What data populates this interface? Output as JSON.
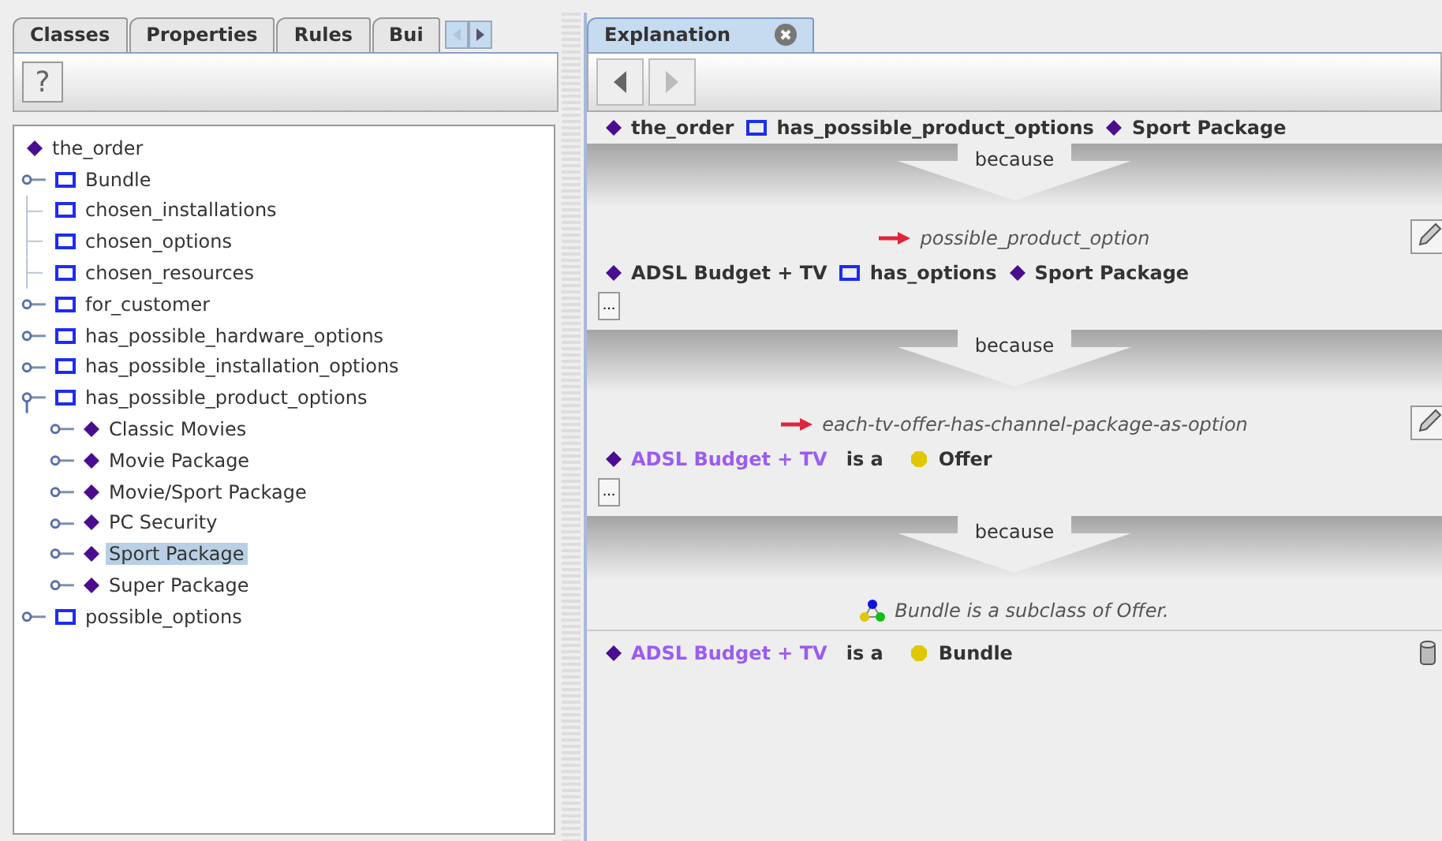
{
  "left_tabs": [
    {
      "label": "Classes",
      "selected": false
    },
    {
      "label": "Properties",
      "selected": false
    },
    {
      "label": "Rules",
      "selected": false
    },
    {
      "label": "Bui",
      "selected": false
    }
  ],
  "left_toolbar": {
    "help_button": "?"
  },
  "tree": [
    {
      "kind": "individual",
      "label": "the_order",
      "selected": false,
      "children": [
        {
          "kind": "property",
          "label": "Bundle",
          "expandable": true,
          "expanded": false,
          "selected": false
        },
        {
          "kind": "property",
          "label": "chosen_installations",
          "expandable": false,
          "selected": false
        },
        {
          "kind": "property",
          "label": "chosen_options",
          "expandable": false,
          "selected": false
        },
        {
          "kind": "property",
          "label": "chosen_resources",
          "expandable": false,
          "selected": false
        },
        {
          "kind": "property",
          "label": "for_customer",
          "expandable": true,
          "expanded": false,
          "selected": false
        },
        {
          "kind": "property",
          "label": "has_possible_hardware_options",
          "expandable": true,
          "expanded": false,
          "selected": false
        },
        {
          "kind": "property",
          "label": "has_possible_installation_options",
          "expandable": true,
          "expanded": false,
          "selected": false
        },
        {
          "kind": "property",
          "label": "has_possible_product_options",
          "expandable": true,
          "expanded": true,
          "selected": false,
          "children": [
            {
              "kind": "individual",
              "label": "Classic Movies",
              "expandable": true,
              "expanded": false,
              "selected": false
            },
            {
              "kind": "individual",
              "label": "Movie Package",
              "expandable": true,
              "expanded": false,
              "selected": false
            },
            {
              "kind": "individual",
              "label": "Movie/Sport Package",
              "expandable": true,
              "expanded": false,
              "selected": false
            },
            {
              "kind": "individual",
              "label": "PC Security",
              "expandable": true,
              "expanded": false,
              "selected": false
            },
            {
              "kind": "individual",
              "label": "Sport Package",
              "expandable": true,
              "expanded": false,
              "selected": true
            },
            {
              "kind": "individual",
              "label": "Super Package",
              "expandable": true,
              "expanded": false,
              "selected": false
            }
          ]
        },
        {
          "kind": "property",
          "label": "possible_options",
          "expandable": true,
          "expanded": false,
          "selected": false
        }
      ]
    }
  ],
  "right_tabs": [
    {
      "label": "Explanation",
      "selected": true
    }
  ],
  "explanation": {
    "statement": [
      {
        "kind": "individual",
        "text": "the_order",
        "inferred": false
      },
      {
        "kind": "property",
        "text": "has_possible_product_options"
      },
      {
        "kind": "individual",
        "text": "Sport Package",
        "inferred": false
      }
    ],
    "steps": [
      {
        "because": "because",
        "justification": {
          "kind": "rule",
          "text": "possible_product_option"
        },
        "statement": [
          {
            "kind": "individual",
            "text": "ADSL Budget + TV",
            "inferred": false
          },
          {
            "kind": "property",
            "text": "has_options"
          },
          {
            "kind": "individual",
            "text": "Sport Package",
            "inferred": false
          }
        ],
        "more_button": "...",
        "editable": true,
        "asserted": false
      },
      {
        "because": "because",
        "justification": {
          "kind": "rule",
          "text": "each-tv-offer-has-channel-package-as-option"
        },
        "statement": [
          {
            "kind": "individual",
            "text": "ADSL Budget + TV",
            "inferred": true
          },
          {
            "kind": "word",
            "text": "is a"
          },
          {
            "kind": "class",
            "text": "Offer"
          }
        ],
        "more_button": "...",
        "editable": true,
        "asserted": false
      },
      {
        "because": "because",
        "justification": {
          "kind": "subclass",
          "text": "Bundle is a subclass of Offer."
        },
        "statement": [
          {
            "kind": "individual",
            "text": "ADSL Budget + TV",
            "inferred": true
          },
          {
            "kind": "word",
            "text": "is a"
          },
          {
            "kind": "class",
            "text": "Bundle"
          }
        ],
        "editable": false,
        "asserted": true
      }
    ]
  }
}
